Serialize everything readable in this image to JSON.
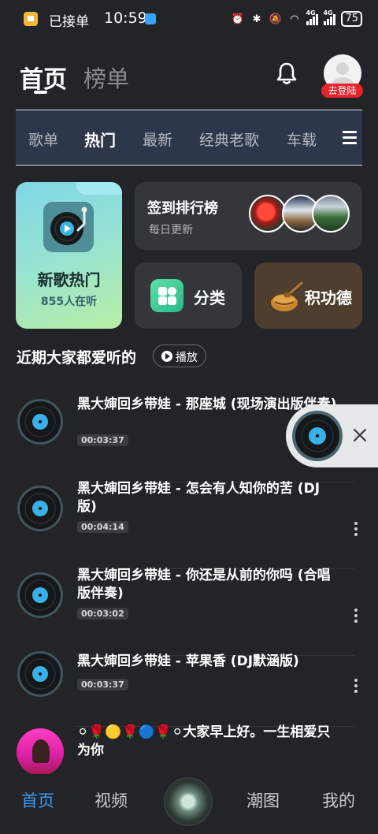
{
  "status_bar": {
    "carrier": "已接单",
    "time": "10:59",
    "network_left": "4G",
    "network_right": "4G",
    "battery": "75"
  },
  "header": {
    "tab_home": "首页",
    "tab_rank": "榜单",
    "login_badge": "去登陆"
  },
  "categories": [
    "歌单",
    "热门",
    "最新",
    "经典老歌",
    "车载"
  ],
  "active_category": "热门",
  "cards": {
    "new_hot": {
      "title": "新歌热门",
      "subtitle": "855人在听"
    },
    "signin": {
      "title": "签到排行榜",
      "subtitle": "每日更新"
    },
    "classify": {
      "label": "分类"
    },
    "merit": {
      "label": "积功德"
    }
  },
  "section": {
    "title": "近期大家都爱听的",
    "play_label": "播放"
  },
  "songs": [
    {
      "title": "黑大婶回乡带娃 - 那座城 (现场演出版伴奏)",
      "duration": "00:03:37"
    },
    {
      "title": "黑大婶回乡带娃 - 怎会有人知你的苦 (DJ版)",
      "duration": "00:04:14"
    },
    {
      "title": "黑大婶回乡带娃 - 你还是从前的你吗 (合唱版伴奏)",
      "duration": "00:03:02"
    },
    {
      "title": "黑大婶回乡带娃 - 苹果香 (DJ默涵版)",
      "duration": "00:03:37"
    },
    {
      "title": "⚪🌹🟡🌹🔵🌹⚪大家早上好。一生相爱只为你",
      "duration": ""
    }
  ],
  "bottom_nav": {
    "home": "首页",
    "video": "视频",
    "trend": "潮图",
    "mine": "我的"
  },
  "colors": {
    "background": "#232427",
    "accent": "#3b9bf5",
    "badge": "#e5232c",
    "category_bar": "#2e3649"
  },
  "icons": [
    "bell-icon",
    "menu-icon",
    "vinyl-disc-icon",
    "class-grid-icon",
    "wooden-fish-icon",
    "play-icon",
    "more-icon",
    "close-icon"
  ]
}
